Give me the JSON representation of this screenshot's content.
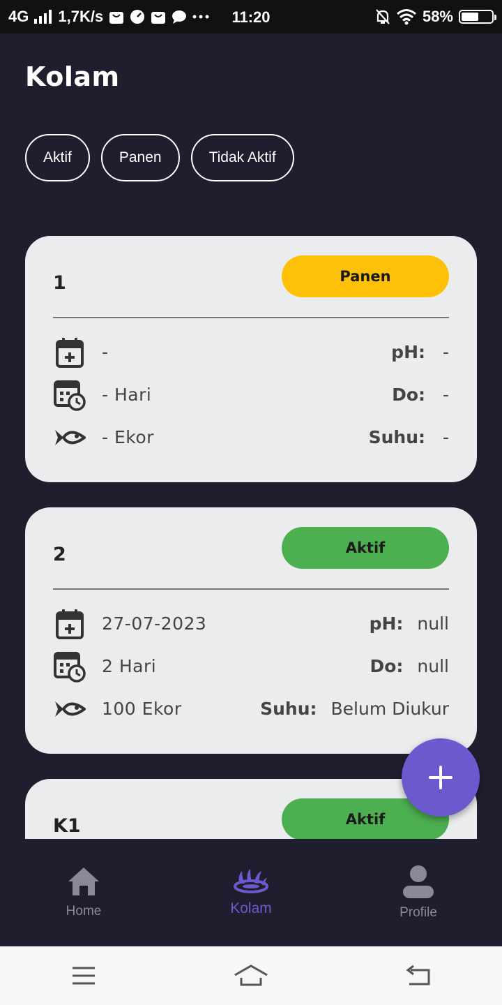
{
  "status_bar": {
    "network": "4G",
    "speed": "1,7K/s",
    "time": "11:20",
    "battery": "58%",
    "battery_level": 0.58
  },
  "page": {
    "title": "Kolam"
  },
  "filters": [
    {
      "label": "Aktif"
    },
    {
      "label": "Panen"
    },
    {
      "label": "Tidak Aktif"
    }
  ],
  "cards": [
    {
      "name": "1",
      "status": "Panen",
      "status_color": "#FFC107",
      "date": "-",
      "days": "- Hari",
      "fish": "- Ekor",
      "ph_label": "pH:",
      "ph": "-",
      "do_label": "Do:",
      "do": "-",
      "suhu_label": "Suhu:",
      "suhu": "-"
    },
    {
      "name": "2",
      "status": "Aktif",
      "status_color": "#4CAF50",
      "date": "27-07-2023",
      "days": "2 Hari",
      "fish": "100 Ekor",
      "ph_label": "pH:",
      "ph": "null",
      "do_label": "Do:",
      "do": "null",
      "suhu_label": "Suhu:",
      "suhu": "Belum Diukur"
    },
    {
      "name": "K1",
      "status": "Aktif",
      "status_color": "#4CAF50"
    }
  ],
  "fab": {
    "icon": "plus-icon"
  },
  "bottom_nav": [
    {
      "label": "Home",
      "icon": "home-icon"
    },
    {
      "label": "Kolam",
      "icon": "pond-icon"
    },
    {
      "label": "Profile",
      "icon": "person-icon"
    }
  ],
  "colors": {
    "background": "#1F1E2E",
    "accent": "#6A5ACD",
    "card": "#EBECEE"
  }
}
